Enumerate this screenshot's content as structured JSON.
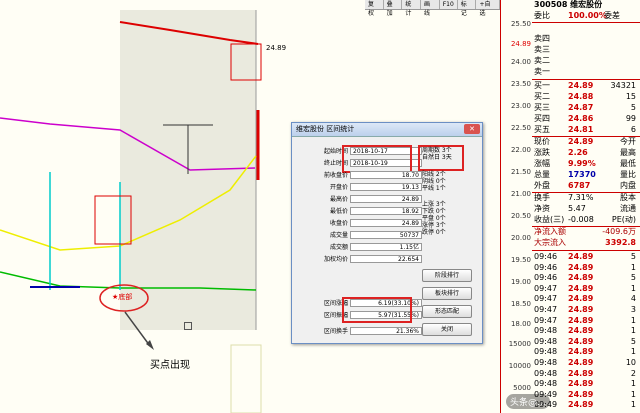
{
  "toolbar": [
    "复权",
    "叠加",
    "统计",
    "画线",
    "F10",
    "标记",
    "+自选"
  ],
  "axis": [
    "25.50",
    "24.89",
    "24.00",
    "23.50",
    "23.00",
    "22.50",
    "22.00",
    "21.50",
    "21.00",
    "20.50",
    "20.00",
    "19.50",
    "19.00",
    "18.50",
    "18.00",
    "15000",
    "10000",
    "5000"
  ],
  "chart": {
    "price_tag": "24.89",
    "marker": "★底部",
    "note": "买点出现"
  },
  "panel": {
    "header": "300508 维宏股份",
    "weibi_label": "委比",
    "weibi_value": "100.00%",
    "weicha_label": "委差",
    "sells": [
      {
        "label": "卖四",
        "price": "",
        "vol": ""
      },
      {
        "label": "卖三",
        "price": "",
        "vol": ""
      },
      {
        "label": "卖二",
        "price": "",
        "vol": ""
      },
      {
        "label": "卖一",
        "price": "",
        "vol": ""
      }
    ],
    "buys": [
      {
        "label": "买一",
        "price": "24.89",
        "vol": "34321"
      },
      {
        "label": "买二",
        "price": "24.88",
        "vol": "15"
      },
      {
        "label": "买三",
        "price": "24.87",
        "vol": "5"
      },
      {
        "label": "买四",
        "price": "24.86",
        "vol": "99"
      },
      {
        "label": "买五",
        "price": "24.81",
        "vol": "6"
      }
    ],
    "quote": [
      {
        "a": "现价",
        "b": "24.89",
        "c": "今开"
      },
      {
        "a": "涨跌",
        "b": "2.26",
        "c": "最高"
      },
      {
        "a": "涨幅",
        "b": "9.99%",
        "c": "最低"
      },
      {
        "a": "总量",
        "b": "17370",
        "c": "量比"
      },
      {
        "a": "外盘",
        "b": "6787",
        "c": "内盘"
      },
      {
        "a": "换手",
        "b": "7.31%",
        "c": "股本"
      },
      {
        "a": "净资",
        "b": "5.47",
        "c": "流通"
      },
      {
        "a": "收益(三)",
        "b": "-0.008",
        "c": "PE(动)"
      },
      {
        "a": "净流入额",
        "b": "",
        "c": "-409.6万"
      },
      {
        "a": "大宗流入",
        "b": "",
        "c": "3392.8"
      }
    ],
    "ticks": [
      {
        "t": "09:46",
        "p": "24.89",
        "v": "5"
      },
      {
        "t": "09:46",
        "p": "24.89",
        "v": "1"
      },
      {
        "t": "09:46",
        "p": "24.89",
        "v": "5"
      },
      {
        "t": "09:47",
        "p": "24.89",
        "v": "1"
      },
      {
        "t": "09:47",
        "p": "24.89",
        "v": "4"
      },
      {
        "t": "09:47",
        "p": "24.89",
        "v": "3"
      },
      {
        "t": "09:47",
        "p": "24.89",
        "v": "1"
      },
      {
        "t": "09:48",
        "p": "24.89",
        "v": "1"
      },
      {
        "t": "09:48",
        "p": "24.89",
        "v": "5"
      },
      {
        "t": "09:48",
        "p": "24.89",
        "v": "1"
      },
      {
        "t": "09:48",
        "p": "24.89",
        "v": "10"
      },
      {
        "t": "09:48",
        "p": "24.89",
        "v": "2"
      },
      {
        "t": "09:48",
        "p": "24.89",
        "v": "1"
      },
      {
        "t": "09:49",
        "p": "24.89",
        "v": "1"
      },
      {
        "t": "09:49",
        "p": "24.89",
        "v": "1"
      }
    ]
  },
  "dialog": {
    "title": "维宏股份 区间统计",
    "start_label": "起始时间",
    "start_value": "2018-10-17",
    "end_label": "终止时间",
    "end_value": "2018-10-19",
    "rows": [
      {
        "l": "前收盘价",
        "v": "18.70"
      },
      {
        "l": "开盘价",
        "v": "19.13"
      },
      {
        "l": "最高价",
        "v": "24.89"
      },
      {
        "l": "最低价",
        "v": "18.92"
      },
      {
        "l": "收盘价",
        "v": "24.89"
      },
      {
        "l": "成交量",
        "v": "50737"
      },
      {
        "l": "加权均价",
        "v": "22.654"
      },
      {
        "l": "区间涨幅",
        "v": "6.19(33.10%)"
      },
      {
        "l": "区间振幅",
        "v": "5.97(31.55%)"
      },
      {
        "l": "区间换手",
        "v": "21.36%"
      }
    ],
    "turnover_label": "成交额",
    "turnover_value": "1.15亿",
    "period": [
      "周期数 3个",
      "自然日 3天"
    ],
    "stats1": [
      "阳线 2个",
      "阴线 0个",
      "平线 1个"
    ],
    "stats2": [
      "上涨 3个",
      "下跌 0个",
      "平盘 0个",
      "涨停 3个",
      "跌停 0个"
    ],
    "buttons": [
      "阶段排行",
      "板块排行",
      "形态匹配",
      "关闭"
    ]
  },
  "watermark": "头条@..."
}
